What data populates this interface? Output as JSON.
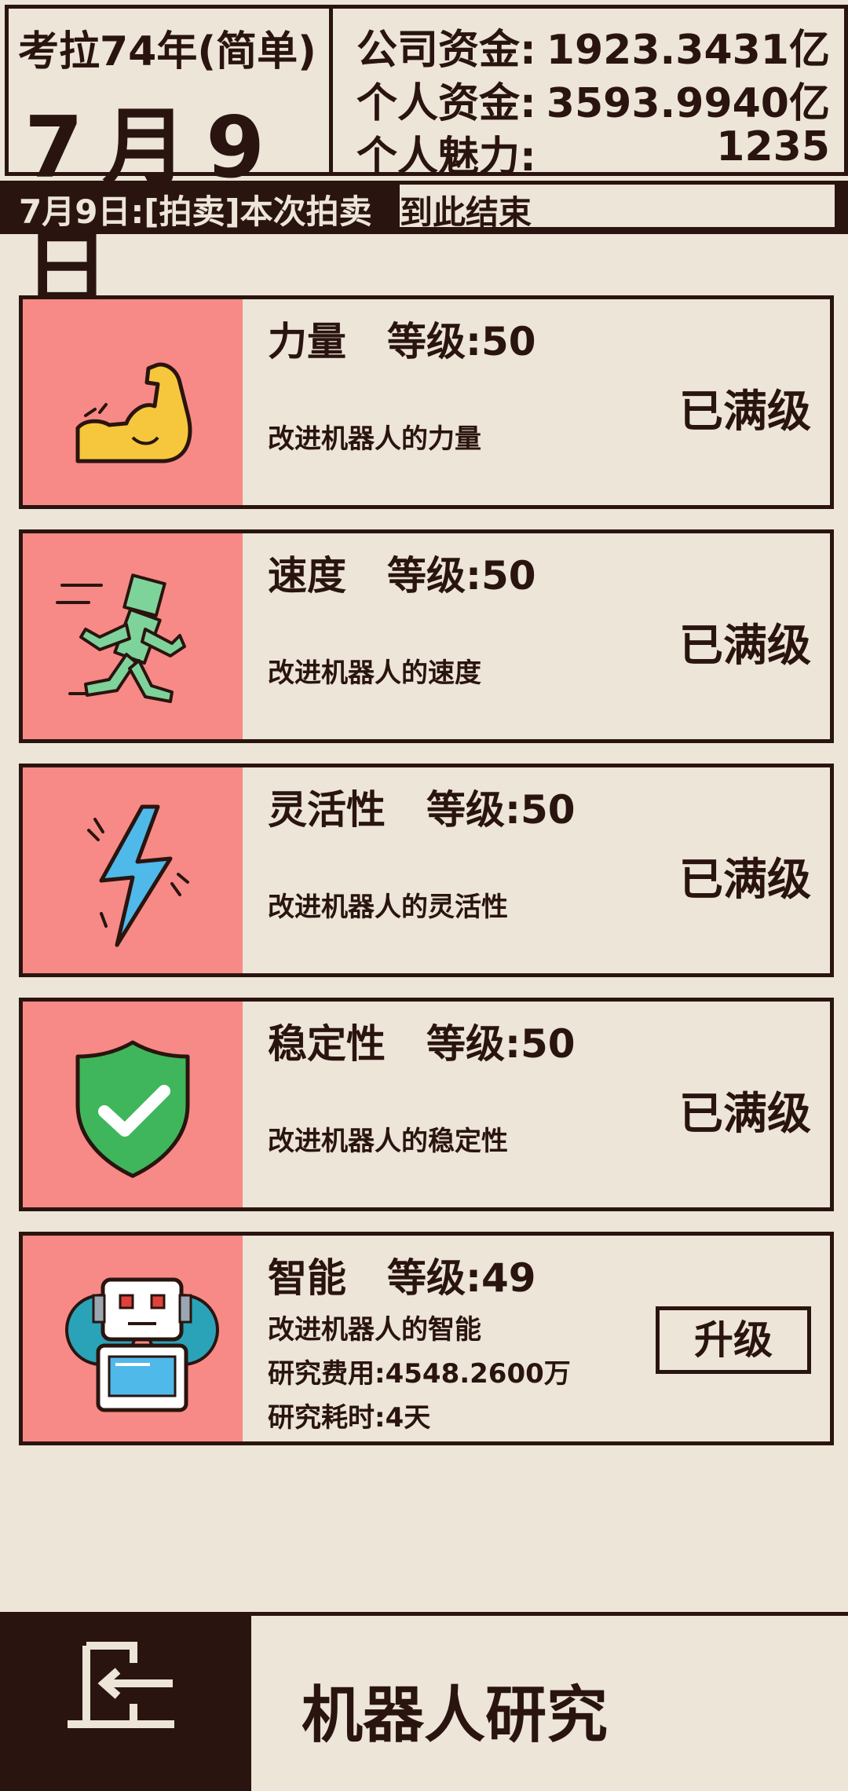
{
  "header": {
    "year_label": "考拉74年(简单)",
    "date_label": "7月9日",
    "company_funds_label": "公司资金:",
    "company_funds_value": "1923.3431亿",
    "personal_funds_label": "个人资金:",
    "personal_funds_value": "3593.9940亿",
    "charm_label": "个人魅力:",
    "charm_value": "1235"
  },
  "ticker": {
    "text_part1": "7月9日:[拍卖]本次拍卖",
    "text_part2": "到此结束"
  },
  "research_items": [
    {
      "name": "力量",
      "level_text": "等级:50",
      "desc": "改进机器人的力量",
      "status": "已满级",
      "icon": "flexed-arm-icon"
    },
    {
      "name": "速度",
      "level_text": "等级:50",
      "desc": "改进机器人的速度",
      "status": "已满级",
      "icon": "running-robot-icon"
    },
    {
      "name": "灵活性",
      "level_text": "等级:50",
      "desc": "改进机器人的灵活性",
      "status": "已满级",
      "icon": "lightning-icon"
    },
    {
      "name": "稳定性",
      "level_text": "等级:50",
      "desc": "改进机器人的稳定性",
      "status": "已满级",
      "icon": "shield-check-icon"
    },
    {
      "name": "智能",
      "level_text": "等级:49",
      "desc": "改进机器人的智能",
      "cost": "研究费用:4548.2600万",
      "duration": "研究耗时:4天",
      "button_label": "升级",
      "icon": "robot-gear-icon"
    }
  ],
  "bottom_bar": {
    "title": "机器人研究",
    "back_icon": "exit-door-icon"
  },
  "colors": {
    "background": "#ece5d8",
    "dark": "#2a140f",
    "icon_pane": "#f78a86"
  }
}
